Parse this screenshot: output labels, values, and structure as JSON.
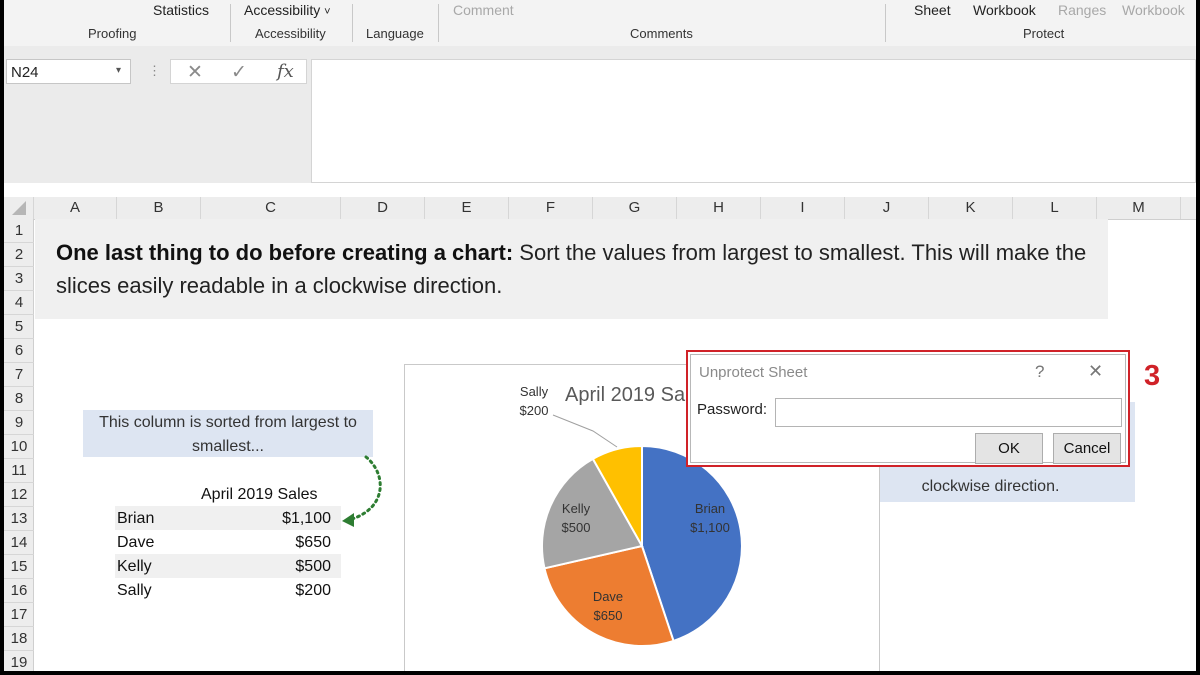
{
  "ribbon": {
    "buttons": {
      "statistics": "Statistics",
      "accessibility": "Accessibility",
      "comment": "Comment",
      "sheet": "Sheet",
      "workbook": "Workbook",
      "ranges": "Ranges",
      "workbook2": "Workbook"
    },
    "groups": {
      "proofing": "Proofing",
      "accessibility": "Accessibility",
      "language": "Language",
      "comments": "Comments",
      "protect": "Protect"
    },
    "dropdown_glyph": "˅"
  },
  "formula_bar": {
    "name_box": "N24",
    "name_box_arrow": "▾",
    "dots": "⋮",
    "cancel_glyph": "✕",
    "enter_glyph": "✓",
    "fx_glyph": "fx",
    "formula": ""
  },
  "grid": {
    "columns": [
      "A",
      "B",
      "C",
      "D",
      "E",
      "F",
      "G",
      "H",
      "I",
      "J",
      "K",
      "L",
      "M"
    ],
    "rows": [
      "1",
      "2",
      "3",
      "4",
      "5",
      "6",
      "7",
      "8",
      "9",
      "10",
      "11",
      "12",
      "13",
      "14",
      "15",
      "16",
      "17",
      "18",
      "19"
    ]
  },
  "tip": {
    "bold": "One last thing to do before creating a chart:",
    "rest": " Sort the values from largest to smallest. This will make the slices easily readable in a clockwise direction."
  },
  "note_left": "This column is sorted from largest to smallest...",
  "note_right": "clockwise direction.",
  "table": {
    "header": "April 2019 Sales",
    "rows": [
      {
        "name": "Brian",
        "value": "$1,100"
      },
      {
        "name": "Dave",
        "value": "$650"
      },
      {
        "name": "Kelly",
        "value": "$500"
      },
      {
        "name": "Sally",
        "value": "$200"
      }
    ]
  },
  "chart_data": {
    "type": "pie",
    "title": "April 2019 Sales",
    "categories": [
      "Brian",
      "Dave",
      "Kelly",
      "Sally"
    ],
    "values": [
      1100,
      650,
      500,
      200
    ],
    "value_labels": [
      "$1,100",
      "$650",
      "$500",
      "$200"
    ],
    "colors": [
      "#4472c4",
      "#ed7d31",
      "#a5a5a5",
      "#ffc000"
    ],
    "start": "12 o'clock",
    "direction": "clockwise",
    "legend": "none"
  },
  "dialog": {
    "title": "Unprotect Sheet",
    "help": "?",
    "close": "✕",
    "password_label": "Password:",
    "password_value": "",
    "ok": "OK",
    "cancel": "Cancel"
  },
  "step_number": "3",
  "colors": {
    "highlight": "#d02228",
    "callout": "#dde5f2",
    "arrow": "#2e7d32"
  }
}
